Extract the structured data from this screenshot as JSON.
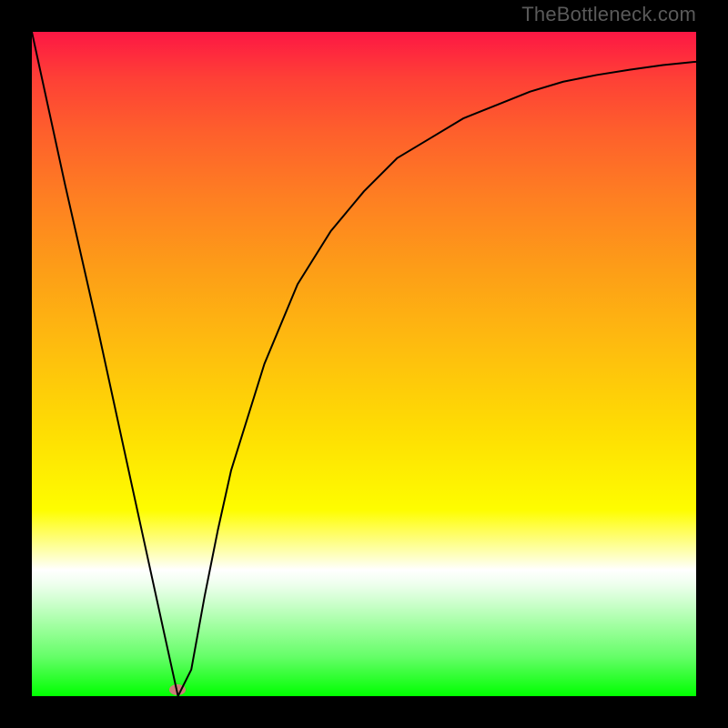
{
  "watermark": "TheBottleneck.com",
  "chart_data": {
    "type": "line",
    "title": "",
    "xlabel": "",
    "ylabel": "",
    "xlim": [
      0,
      100
    ],
    "ylim": [
      0,
      100
    ],
    "grid": false,
    "legend": false,
    "background_gradient": {
      "top": "#fd1744",
      "bottom": "#00ff00"
    },
    "series": [
      {
        "name": "bottleneck-curve",
        "color": "#000000",
        "x": [
          0,
          5,
          10,
          15,
          20,
          22,
          24,
          26,
          28,
          30,
          35,
          40,
          45,
          50,
          55,
          60,
          65,
          70,
          75,
          80,
          85,
          90,
          95,
          100
        ],
        "y": [
          100,
          77,
          55,
          32,
          9,
          0,
          4,
          15,
          25,
          34,
          50,
          62,
          70,
          76,
          81,
          84,
          87,
          89,
          91,
          92.5,
          93.5,
          94.3,
          95,
          95.5
        ]
      }
    ],
    "marker": {
      "name": "min-point",
      "x": 22,
      "y": 0,
      "color": "#cd7e79"
    }
  }
}
